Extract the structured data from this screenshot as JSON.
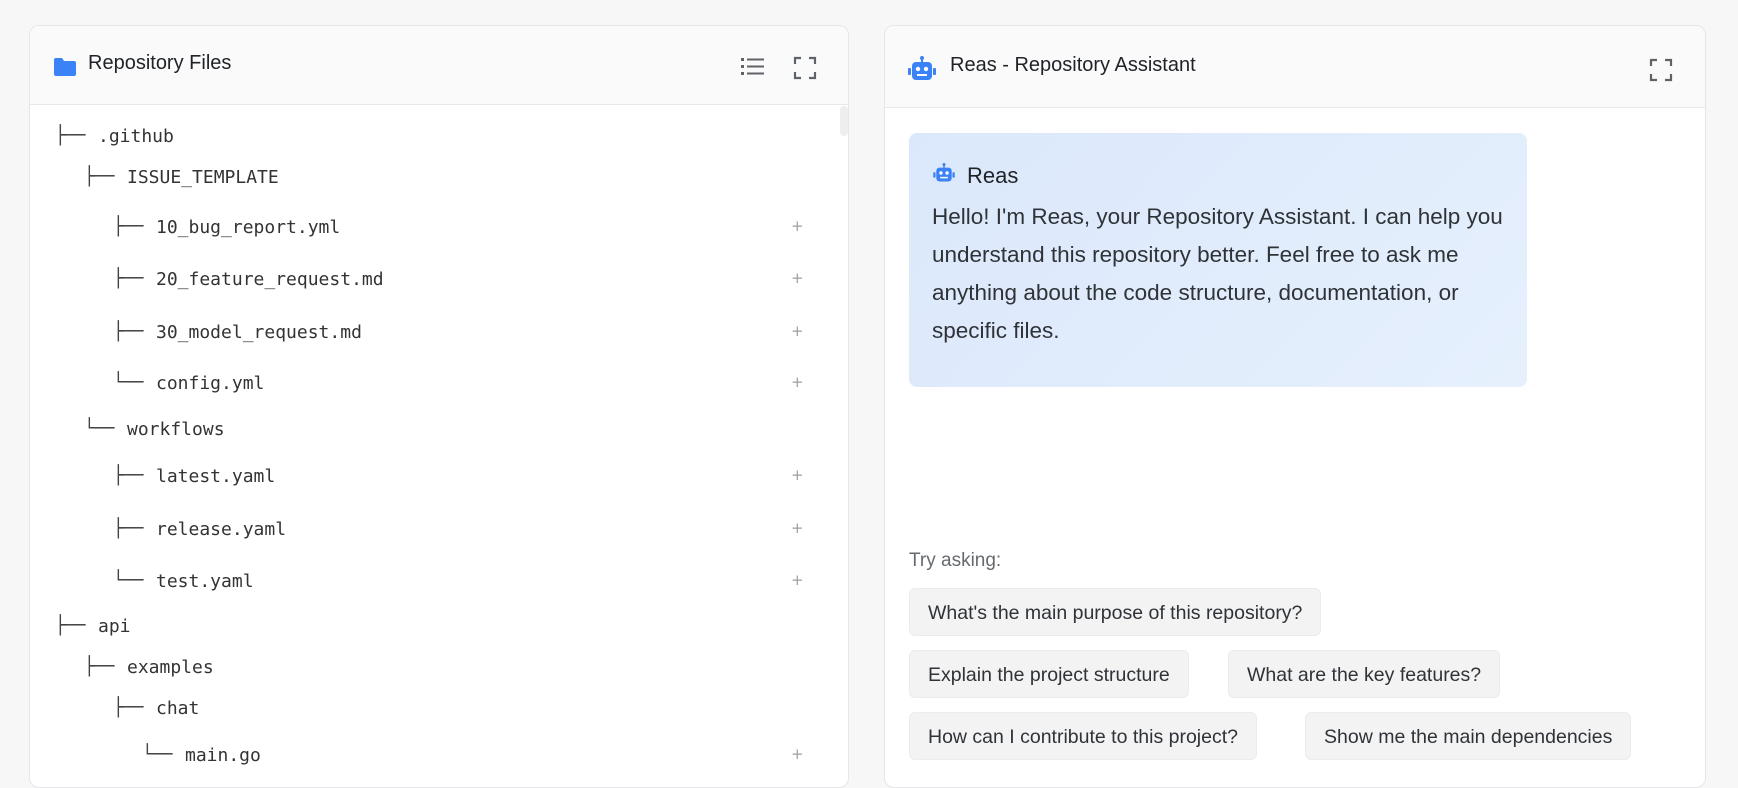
{
  "left_panel": {
    "title": "Repository Files",
    "icons": [
      "folder-icon",
      "list-view-icon",
      "expand-icon"
    ],
    "add_symbol": "+",
    "tree": [
      {
        "branch": "├──",
        "name": ".github",
        "depth": 0,
        "type": "folder"
      },
      {
        "branch": "├──",
        "name": "ISSUE_TEMPLATE",
        "depth": 1,
        "type": "folder"
      },
      {
        "branch": "├──",
        "name": "10_bug_report.yml",
        "depth": 2,
        "type": "file"
      },
      {
        "branch": "├──",
        "name": "20_feature_request.md",
        "depth": 2,
        "type": "file"
      },
      {
        "branch": "├──",
        "name": "30_model_request.md",
        "depth": 2,
        "type": "file"
      },
      {
        "branch": "└──",
        "name": "config.yml",
        "depth": 2,
        "type": "file"
      },
      {
        "branch": "└──",
        "name": "workflows",
        "depth": 1,
        "type": "folder"
      },
      {
        "branch": "├──",
        "name": "latest.yaml",
        "depth": 2,
        "type": "file"
      },
      {
        "branch": "├──",
        "name": "release.yaml",
        "depth": 2,
        "type": "file"
      },
      {
        "branch": "└──",
        "name": "test.yaml",
        "depth": 2,
        "type": "file"
      },
      {
        "branch": "├──",
        "name": "api",
        "depth": 0,
        "type": "folder"
      },
      {
        "branch": "├──",
        "name": "examples",
        "depth": 1,
        "type": "folder"
      },
      {
        "branch": "├──",
        "name": "chat",
        "depth": 2,
        "type": "folder"
      },
      {
        "branch": "└──",
        "name": "main.go",
        "depth": 3,
        "type": "file"
      }
    ]
  },
  "right_panel": {
    "title": "Reas - Repository Assistant",
    "icons": [
      "robot-icon",
      "expand-icon"
    ],
    "message": {
      "sender": "Reas",
      "text": "Hello! I'm Reas, your Repository Assistant. I can help you understand this repository better. Feel free to ask me anything about the code structure, documentation, or specific files."
    },
    "try_asking_label": "Try asking:",
    "suggestions": [
      "What's the main purpose of this repository?",
      "Explain the project structure",
      "What are the key features?",
      "How can I contribute to this project?",
      "Show me the main dependencies"
    ]
  },
  "colors": {
    "accent": "#3b82f6",
    "bubble_bg": "#dfeafc",
    "chip_bg": "#f3f3f4"
  }
}
